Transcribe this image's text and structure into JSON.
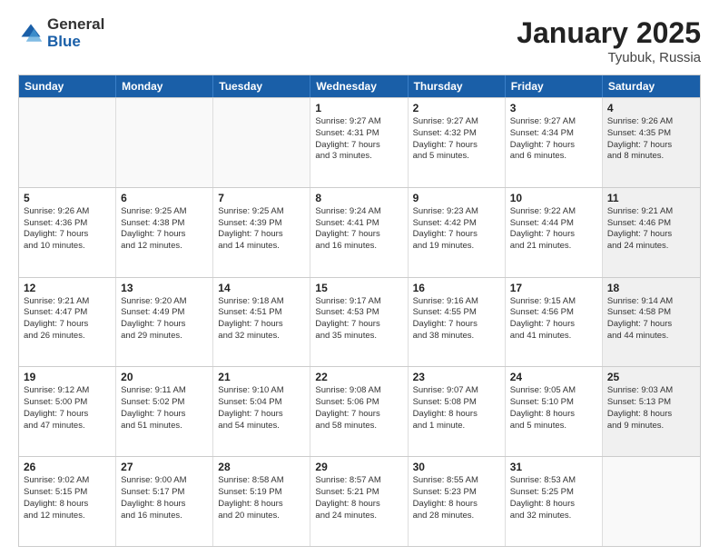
{
  "logo": {
    "general": "General",
    "blue": "Blue"
  },
  "title": "January 2025",
  "subtitle": "Tyubuk, Russia",
  "headers": [
    "Sunday",
    "Monday",
    "Tuesday",
    "Wednesday",
    "Thursday",
    "Friday",
    "Saturday"
  ],
  "weeks": [
    [
      {
        "day": "",
        "info": "",
        "empty": true
      },
      {
        "day": "",
        "info": "",
        "empty": true
      },
      {
        "day": "",
        "info": "",
        "empty": true
      },
      {
        "day": "1",
        "info": "Sunrise: 9:27 AM\nSunset: 4:31 PM\nDaylight: 7 hours\nand 3 minutes."
      },
      {
        "day": "2",
        "info": "Sunrise: 9:27 AM\nSunset: 4:32 PM\nDaylight: 7 hours\nand 5 minutes."
      },
      {
        "day": "3",
        "info": "Sunrise: 9:27 AM\nSunset: 4:34 PM\nDaylight: 7 hours\nand 6 minutes."
      },
      {
        "day": "4",
        "info": "Sunrise: 9:26 AM\nSunset: 4:35 PM\nDaylight: 7 hours\nand 8 minutes.",
        "shaded": true
      }
    ],
    [
      {
        "day": "5",
        "info": "Sunrise: 9:26 AM\nSunset: 4:36 PM\nDaylight: 7 hours\nand 10 minutes."
      },
      {
        "day": "6",
        "info": "Sunrise: 9:25 AM\nSunset: 4:38 PM\nDaylight: 7 hours\nand 12 minutes."
      },
      {
        "day": "7",
        "info": "Sunrise: 9:25 AM\nSunset: 4:39 PM\nDaylight: 7 hours\nand 14 minutes."
      },
      {
        "day": "8",
        "info": "Sunrise: 9:24 AM\nSunset: 4:41 PM\nDaylight: 7 hours\nand 16 minutes."
      },
      {
        "day": "9",
        "info": "Sunrise: 9:23 AM\nSunset: 4:42 PM\nDaylight: 7 hours\nand 19 minutes."
      },
      {
        "day": "10",
        "info": "Sunrise: 9:22 AM\nSunset: 4:44 PM\nDaylight: 7 hours\nand 21 minutes."
      },
      {
        "day": "11",
        "info": "Sunrise: 9:21 AM\nSunset: 4:46 PM\nDaylight: 7 hours\nand 24 minutes.",
        "shaded": true
      }
    ],
    [
      {
        "day": "12",
        "info": "Sunrise: 9:21 AM\nSunset: 4:47 PM\nDaylight: 7 hours\nand 26 minutes."
      },
      {
        "day": "13",
        "info": "Sunrise: 9:20 AM\nSunset: 4:49 PM\nDaylight: 7 hours\nand 29 minutes."
      },
      {
        "day": "14",
        "info": "Sunrise: 9:18 AM\nSunset: 4:51 PM\nDaylight: 7 hours\nand 32 minutes."
      },
      {
        "day": "15",
        "info": "Sunrise: 9:17 AM\nSunset: 4:53 PM\nDaylight: 7 hours\nand 35 minutes."
      },
      {
        "day": "16",
        "info": "Sunrise: 9:16 AM\nSunset: 4:55 PM\nDaylight: 7 hours\nand 38 minutes."
      },
      {
        "day": "17",
        "info": "Sunrise: 9:15 AM\nSunset: 4:56 PM\nDaylight: 7 hours\nand 41 minutes."
      },
      {
        "day": "18",
        "info": "Sunrise: 9:14 AM\nSunset: 4:58 PM\nDaylight: 7 hours\nand 44 minutes.",
        "shaded": true
      }
    ],
    [
      {
        "day": "19",
        "info": "Sunrise: 9:12 AM\nSunset: 5:00 PM\nDaylight: 7 hours\nand 47 minutes."
      },
      {
        "day": "20",
        "info": "Sunrise: 9:11 AM\nSunset: 5:02 PM\nDaylight: 7 hours\nand 51 minutes."
      },
      {
        "day": "21",
        "info": "Sunrise: 9:10 AM\nSunset: 5:04 PM\nDaylight: 7 hours\nand 54 minutes."
      },
      {
        "day": "22",
        "info": "Sunrise: 9:08 AM\nSunset: 5:06 PM\nDaylight: 7 hours\nand 58 minutes."
      },
      {
        "day": "23",
        "info": "Sunrise: 9:07 AM\nSunset: 5:08 PM\nDaylight: 8 hours\nand 1 minute."
      },
      {
        "day": "24",
        "info": "Sunrise: 9:05 AM\nSunset: 5:10 PM\nDaylight: 8 hours\nand 5 minutes."
      },
      {
        "day": "25",
        "info": "Sunrise: 9:03 AM\nSunset: 5:13 PM\nDaylight: 8 hours\nand 9 minutes.",
        "shaded": true
      }
    ],
    [
      {
        "day": "26",
        "info": "Sunrise: 9:02 AM\nSunset: 5:15 PM\nDaylight: 8 hours\nand 12 minutes."
      },
      {
        "day": "27",
        "info": "Sunrise: 9:00 AM\nSunset: 5:17 PM\nDaylight: 8 hours\nand 16 minutes."
      },
      {
        "day": "28",
        "info": "Sunrise: 8:58 AM\nSunset: 5:19 PM\nDaylight: 8 hours\nand 20 minutes."
      },
      {
        "day": "29",
        "info": "Sunrise: 8:57 AM\nSunset: 5:21 PM\nDaylight: 8 hours\nand 24 minutes."
      },
      {
        "day": "30",
        "info": "Sunrise: 8:55 AM\nSunset: 5:23 PM\nDaylight: 8 hours\nand 28 minutes."
      },
      {
        "day": "31",
        "info": "Sunrise: 8:53 AM\nSunset: 5:25 PM\nDaylight: 8 hours\nand 32 minutes."
      },
      {
        "day": "",
        "info": "",
        "empty": true,
        "shaded": true
      }
    ]
  ]
}
